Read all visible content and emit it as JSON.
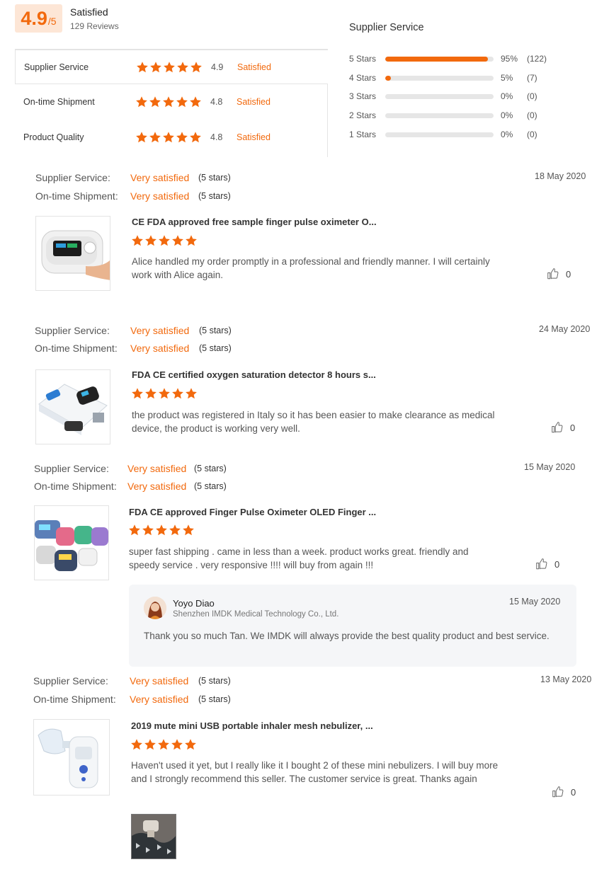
{
  "summary": {
    "score": "4.9",
    "score_suffix": "/5",
    "label": "Satisfied",
    "reviews_count": "129 Reviews",
    "metrics": [
      {
        "name": "Supplier Service",
        "value": "4.9",
        "label": "Satisfied"
      },
      {
        "name": "On-time Shipment",
        "value": "4.8",
        "label": "Satisfied"
      },
      {
        "name": "Product Quality",
        "value": "4.8",
        "label": "Satisfied"
      }
    ],
    "distribution": {
      "title": "Supplier Service",
      "rows": [
        {
          "label": "5 Stars",
          "percent": "95%",
          "count": "(122)",
          "fill_pct": 95
        },
        {
          "label": "4 Stars",
          "percent": "5%",
          "count": "(7)",
          "fill_pct": 5
        },
        {
          "label": "3 Stars",
          "percent": "0%",
          "count": "(0)",
          "fill_pct": 0
        },
        {
          "label": "2 Stars",
          "percent": "0%",
          "count": "(0)",
          "fill_pct": 0
        },
        {
          "label": "1 Stars",
          "percent": "0%",
          "count": "(0)",
          "fill_pct": 0
        }
      ]
    }
  },
  "reviews": [
    {
      "supplier_label": "Supplier Service:",
      "supplier_value": "Very satisfied",
      "supplier_stars": "(5 stars)",
      "shipment_label": "On-time Shipment:",
      "shipment_value": "Very satisfied",
      "shipment_stars": "(5 stars)",
      "date": "18 May 2020",
      "product_title": "CE FDA approved free sample finger pulse oximeter O...",
      "rating": 5,
      "body": "Alice handled my order promptly in a professional and friendly manner. I will certainly work with Alice again.",
      "likes": "0"
    },
    {
      "supplier_label": "Supplier Service:",
      "supplier_value": "Very satisfied",
      "supplier_stars": "(5 stars)",
      "shipment_label": "On-time Shipment:",
      "shipment_value": "Very satisfied",
      "shipment_stars": "(5 stars)",
      "date": "24 May 2020",
      "product_title": "FDA CE certified oxygen saturation detector 8 hours s...",
      "rating": 5,
      "body": "the product was registered in Italy so it has been easier to make clearance as medical device, the product is working very well.",
      "likes": "0"
    },
    {
      "supplier_label": "Supplier Service:",
      "supplier_value": "Very satisfied",
      "supplier_stars": "(5 stars)",
      "shipment_label": "On-time Shipment:",
      "shipment_value": "Very satisfied",
      "shipment_stars": "(5 stars)",
      "date": "15 May 2020",
      "product_title": "FDA CE approved Finger Pulse Oximeter OLED Finger ...",
      "rating": 5,
      "body": "super fast shipping . came in less than a week. product works great. friendly and speedy service . very responsive !!!! will buy from again !!!",
      "likes": "0",
      "reply": {
        "name": "Yoyo Diao",
        "company": "Shenzhen IMDK Medical Technology Co., Ltd.",
        "date": "15 May 2020",
        "text": "Thank you so much Tan. We IMDK will always provide the best quality product and best service."
      }
    },
    {
      "supplier_label": "Supplier Service:",
      "supplier_value": "Very satisfied",
      "supplier_stars": "(5 stars)",
      "shipment_label": "On-time Shipment:",
      "shipment_value": "Very satisfied",
      "shipment_stars": "(5 stars)",
      "date": "13 May 2020",
      "product_title": "2019 mute mini USB portable inhaler mesh nebulizer, ...",
      "rating": 5,
      "body": "Haven't used it yet, but I really like it I bought 2 of these mini nebulizers. I will buy more and I strongly recommend this seller. The customer service is great. Thanks again",
      "likes": "0"
    }
  ],
  "colors": {
    "accent": "#f2690d",
    "accent_light": "#fde6d6",
    "reply_bg": "#f5f6f8"
  }
}
